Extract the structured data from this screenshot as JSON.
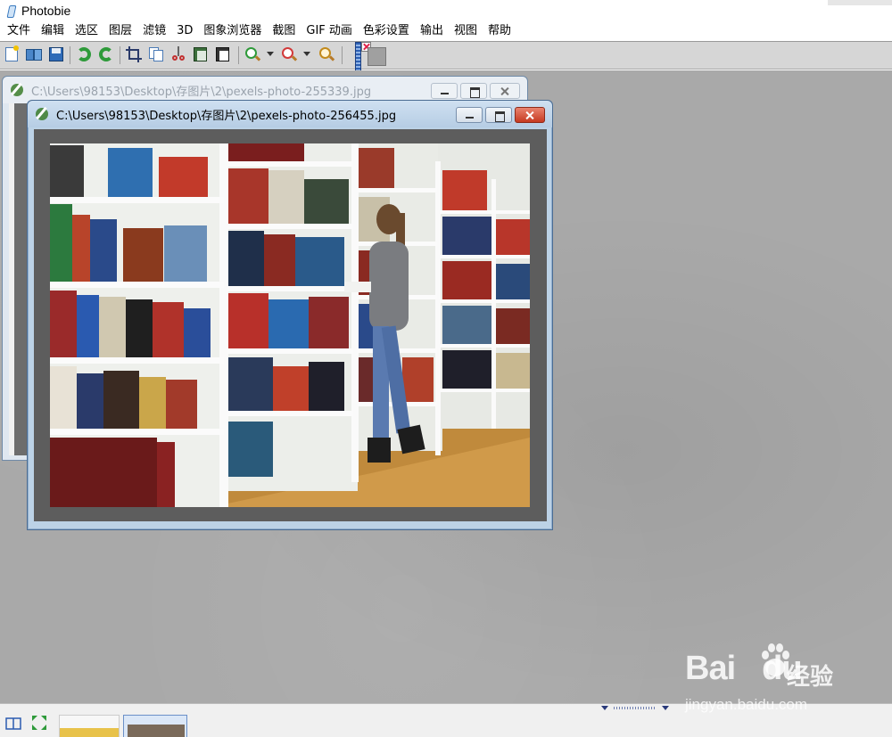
{
  "app": {
    "title": "Photobie"
  },
  "menu": {
    "items": [
      "文件",
      "编辑",
      "选区",
      "图层",
      "滤镜",
      "3D",
      "图象浏览器",
      "截图",
      "GIF 动画",
      "色彩设置",
      "输出",
      "视图",
      "帮助"
    ]
  },
  "toolbar": {
    "icons": [
      "new-image-icon",
      "open-book-icon",
      "save-icon",
      "undo-icon",
      "redo-icon",
      "crop-icon",
      "copy-icon",
      "cut-icon",
      "paste-icon",
      "paste-new-icon",
      "zoom-in-icon",
      "zoom-out-icon",
      "zoom-actual-icon"
    ]
  },
  "windows": {
    "back": {
      "title": "C:\\Users\\98153\\Desktop\\存图片\\2\\pexels-photo-255339.jpg"
    },
    "front": {
      "title": "C:\\Users\\98153\\Desktop\\存图片\\2\\pexels-photo-256455.jpg"
    }
  },
  "watermark": {
    "brand": "Bai",
    "brand_tail": "du",
    "brand_cn": "经验",
    "url": "jingyan.baidu.com"
  },
  "colors": {
    "workspace": "#a9a9a9",
    "toolbar": "#d6d6d6",
    "active_title": "#b6cde4",
    "close_button": "#c63a21"
  }
}
